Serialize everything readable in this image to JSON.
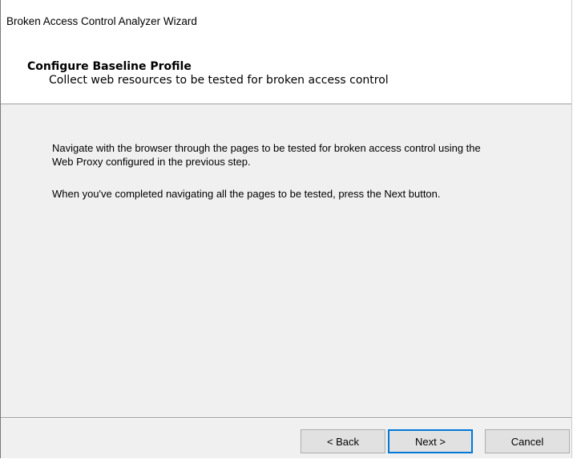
{
  "window": {
    "title": "Broken Access Control Analyzer Wizard"
  },
  "header": {
    "title": "Configure Baseline Profile",
    "subtitle": "Collect web resources to be tested for broken access control"
  },
  "content": {
    "paragraph1": "Navigate with the browser through the pages to be tested for broken access control using the Web Proxy configured in the previous step.",
    "paragraph2": "When you've completed navigating all the pages to be tested, press the Next button."
  },
  "buttons": {
    "back": "< Back",
    "next": "Next >",
    "cancel": "Cancel"
  },
  "colors": {
    "accent": "#0078d7",
    "dialog_background": "#f0f0f0",
    "header_background": "#ffffff"
  }
}
